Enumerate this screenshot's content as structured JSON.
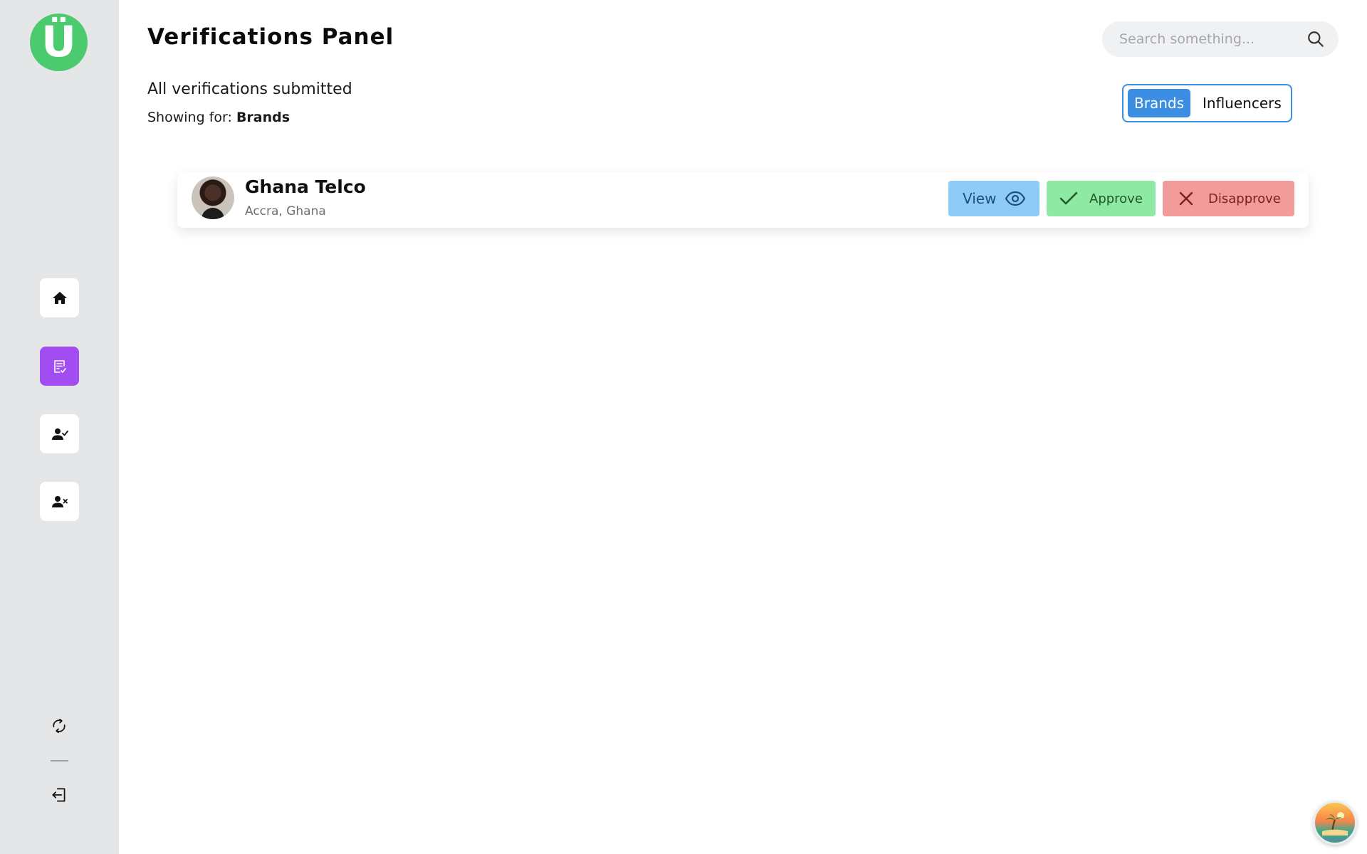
{
  "app": {
    "logo_letter": "Ü",
    "accent_color": "#a24df2",
    "logo_color": "#4ccb6e"
  },
  "sidebar": {
    "items": [
      {
        "name": "home",
        "icon": "home-icon",
        "active": false
      },
      {
        "name": "verifications",
        "icon": "checklist-icon",
        "active": true
      },
      {
        "name": "verified-users",
        "icon": "user-check-icon",
        "active": false
      },
      {
        "name": "rejected-users",
        "icon": "user-x-icon",
        "active": false
      }
    ],
    "bottom": [
      {
        "name": "refresh",
        "icon": "refresh-icon"
      },
      {
        "name": "logout",
        "icon": "logout-icon"
      }
    ]
  },
  "header": {
    "title": "Verifications Panel",
    "search_placeholder": "Search something..."
  },
  "main": {
    "subtitle": "All verifications submitted",
    "showing_label": "Showing for:",
    "showing_value": "Brands",
    "toggle": {
      "options": [
        "Brands",
        "Influencers"
      ],
      "selected": "Brands"
    },
    "records": [
      {
        "name": "Ghana Telco",
        "location": "Accra, Ghana",
        "actions": {
          "view": "View",
          "approve": "Approve",
          "disapprove": "Disapprove"
        }
      }
    ]
  },
  "colors": {
    "view_bg": "#8ecbf7",
    "approve_bg": "#8eeaa2",
    "disapprove_bg": "#f19b9b",
    "toggle_active": "#3c8ee3"
  }
}
